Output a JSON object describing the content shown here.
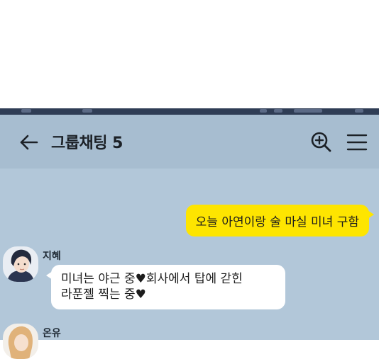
{
  "header": {
    "title": "그룹채팅 5",
    "back_icon": "arrow-left-icon",
    "search_icon": "search-plus-icon",
    "menu_icon": "hamburger-menu-icon"
  },
  "messages": [
    {
      "from": "me",
      "text": "오늘 아연이랑 술 마실 미녀 구함"
    },
    {
      "from": "other",
      "sender": "지혜",
      "lines": [
        "미녀는 야근 중♥회사에서 탑에 갇힌",
        "라푼젤 찍는 중♥"
      ]
    },
    {
      "from": "other",
      "sender": "온유"
    }
  ],
  "colors": {
    "chat_bg": "#b2c7d9",
    "header_bg": "#a7bdd0",
    "my_bubble": "#fee500",
    "other_bubble": "#ffffff",
    "status_bar": "#2f3d55"
  }
}
